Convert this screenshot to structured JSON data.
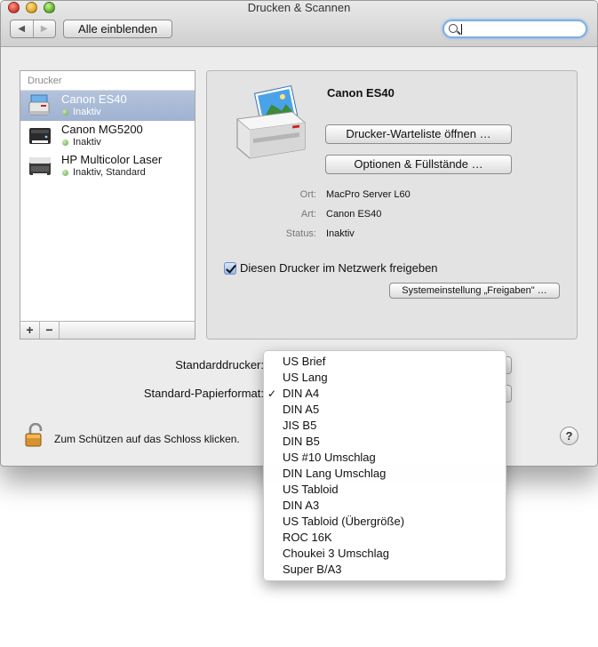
{
  "window": {
    "title": "Drucken & Scannen"
  },
  "toolbar": {
    "back_glyph": "◀",
    "forward_glyph": "▶",
    "show_all_label": "Alle einblenden",
    "search_value": ""
  },
  "printer_list": {
    "header": "Drucker",
    "items": [
      {
        "name": "Canon ES40",
        "status": "Inaktiv",
        "selected": true
      },
      {
        "name": "Canon MG5200",
        "status": "Inaktiv",
        "selected": false
      },
      {
        "name": "HP Multicolor Laser",
        "status": "Inaktiv, Standard",
        "selected": false
      }
    ],
    "add_label": "+",
    "remove_label": "−"
  },
  "details": {
    "printer_name": "Canon ES40",
    "queue_button": "Drucker-Warteliste öffnen …",
    "options_button": "Optionen & Füllstände …",
    "fields": [
      {
        "label": "Ort:",
        "value": "MacPro Server L60"
      },
      {
        "label": "Art:",
        "value": "Canon ES40"
      },
      {
        "label": "Status:",
        "value": "Inaktiv"
      }
    ],
    "share_checkbox_label": "Diesen Drucker im Netzwerk freigeben",
    "share_checked": true,
    "sharing_prefs_button": "Systemeinstellung „Freigaben\" …"
  },
  "defaults": {
    "default_printer_label": "Standarddrucker:",
    "default_paper_label": "Standard-Papierformat:"
  },
  "footer": {
    "lock_label": "Zum Schützen auf das Schloss klicken.",
    "help_label": "?"
  },
  "paper_menu": {
    "check_glyph": "✓",
    "selected_index": 2,
    "options": [
      "US Brief",
      "US Lang",
      "DIN A4",
      "DIN A5",
      "JIS B5",
      "DIN B5",
      "US #10 Umschlag",
      "DIN Lang Umschlag",
      "US Tabloid",
      "DIN A3",
      "US Tabloid (Übergröße)",
      "ROC 16K",
      "Choukei 3 Umschlag",
      "Super B/A3"
    ]
  }
}
